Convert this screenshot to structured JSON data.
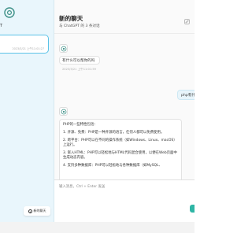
{
  "sidebar": {
    "header_fragment": "T",
    "session": {
      "time": "2023/3/21 上午11:01:27"
    },
    "new_chat_label": "新的聊天"
  },
  "chat": {
    "title": "新的聊天",
    "subtitle": "与 ChatGPT 的 3 条对话",
    "messages": {
      "user_1": "有什么可以帮你的吗",
      "user_1_time": "2023/3/21 上午11:01:59",
      "user_2": "php有什么",
      "bot_paragraphs": [
        "PHP的一些特性包括：",
        "1. 开源、免费：PHP是一种开源的语言，任何人都可以免费使用。",
        "2. 跨平台：PHP可以在不同的操作系统（如Windows、Linux、macOS）上运行。",
        "3. 嵌入HTML：PHP可以轻松地与HTML代码混合使用，以便在Web页面中生成动态内容。",
        "4. 支持多种数据库：PHP可以轻松地与各种数据库（如MySQL、"
      ]
    },
    "input_placeholder": "输入消息，Ctrl + Enter 发送"
  },
  "colors": {
    "sidebar_bg": "#e9f6fc",
    "accent": "#5bc2e7",
    "send_button": "#2fb5a5"
  },
  "icons": [
    "openai-logo-icon",
    "chat-bubble-icon",
    "edit-icon",
    "plus-icon"
  ]
}
